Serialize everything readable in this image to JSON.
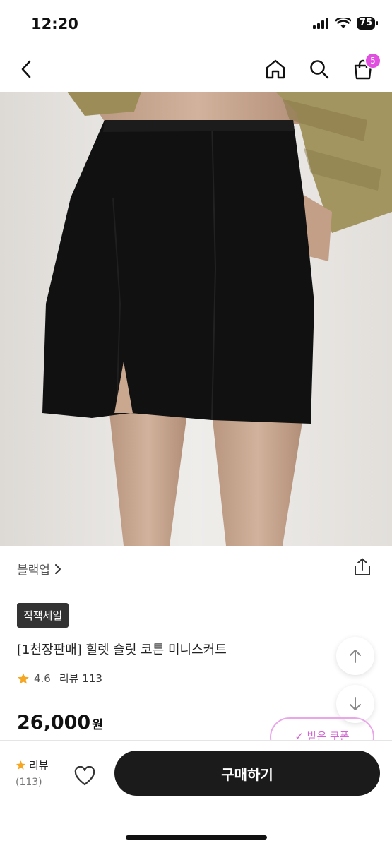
{
  "status": {
    "time": "12:20",
    "battery": "75"
  },
  "nav": {
    "cart_count": "5"
  },
  "brand": {
    "name": "블랙업"
  },
  "product": {
    "badge": "직잭세일",
    "title": "[1천장판매] 힐렛 슬릿 코튼 미니스커트",
    "rating": "4.6",
    "review_label": "리뷰 113",
    "price": "26,000",
    "currency": "원"
  },
  "coupon": {
    "label": "✓ 받은 쿠폰"
  },
  "bottom": {
    "review_label": "리뷰",
    "review_count": "(113)",
    "buy_label": "구매하기"
  },
  "colors": {
    "accent": "#e04fe0",
    "star": "#f5a623",
    "buy_bg": "#1b1b1b"
  }
}
